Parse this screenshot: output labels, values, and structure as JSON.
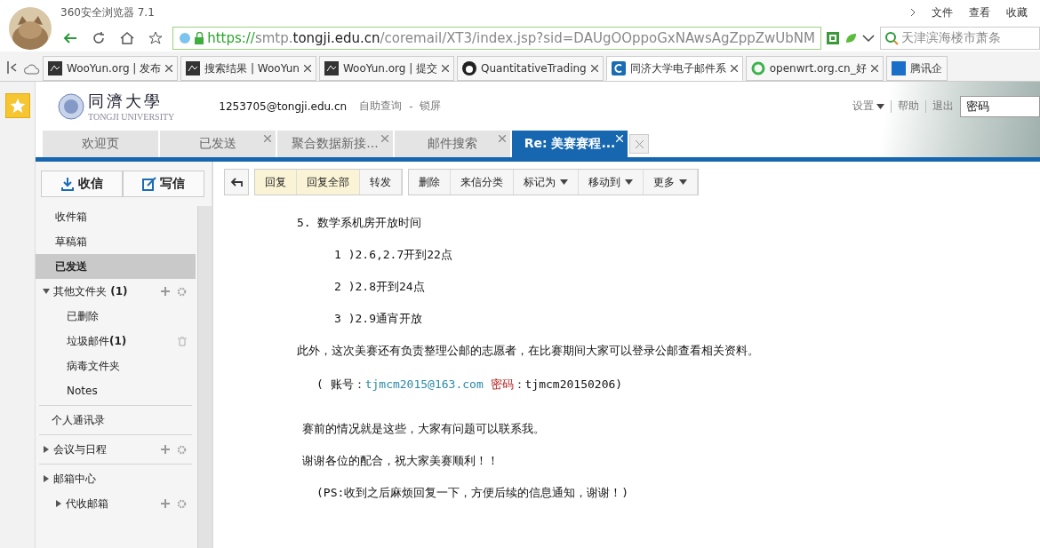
{
  "browser": {
    "title": "360安全浏览器 7.1",
    "menu": [
      "文件",
      "查看",
      "收藏"
    ],
    "url": [
      {
        "kind": "scheme",
        "text": "https://"
      },
      {
        "kind": "sub",
        "text": "smtp."
      },
      {
        "kind": "domain",
        "text": "tongji.edu.cn"
      },
      {
        "kind": "path",
        "text": "/coremail/XT3/index.jsp?sid=DAUgOOppoGxNAwsAgZppZwUbNM"
      }
    ],
    "search": {
      "value": "天津滨海楼市萧条"
    },
    "tabs": [
      {
        "label": "WooYun.org | 发布",
        "selected": false
      },
      {
        "label": "搜索结果 | WooYun",
        "selected": false
      },
      {
        "label": "WooYun.org | 提交",
        "selected": false
      },
      {
        "label": "QuantitativeTrading",
        "selected": false
      },
      {
        "label": "同济大学电子邮件系",
        "selected": true
      },
      {
        "label": "openwrt.org.cn_好",
        "selected": false
      },
      {
        "label": "腾讯企",
        "selected": false
      }
    ]
  },
  "mail": {
    "logo": {
      "cn": "同濟大學",
      "en": "TONGJI UNIVERSITY"
    },
    "account": "1253705@tongji.edu.cn",
    "links": [
      "自助查询",
      "锁屏"
    ],
    "separator": "-",
    "top_links": [
      "设置",
      "帮助",
      "退出"
    ],
    "search": {
      "value": "密码"
    },
    "tabs": [
      {
        "label": "欢迎页",
        "closable": false,
        "selected": false
      },
      {
        "label": "已发送",
        "closable": true,
        "selected": false
      },
      {
        "label": "聚合数据新接...",
        "closable": true,
        "selected": false
      },
      {
        "label": "邮件搜索",
        "closable": true,
        "selected": false
      },
      {
        "label": "Re: 美赛赛程...",
        "closable": true,
        "selected": true
      }
    ],
    "actions": [
      "收信",
      "写信"
    ],
    "toolbar_reply": [
      {
        "label": "回复",
        "highlight": true
      },
      {
        "label": "回复全部",
        "highlight": true
      },
      {
        "label": "转发",
        "highlight": false
      }
    ],
    "toolbar_manage": [
      {
        "label": "删除",
        "dropdown": false
      },
      {
        "label": "来信分类",
        "dropdown": false
      },
      {
        "label": "标记为",
        "dropdown": true
      },
      {
        "label": "移动到",
        "dropdown": true
      },
      {
        "label": "更多",
        "dropdown": true
      }
    ],
    "folders": [
      {
        "label": "收件箱",
        "kind": "plain",
        "selected": false
      },
      {
        "label": "草稿箱",
        "kind": "plain",
        "selected": false
      },
      {
        "label": "已发送",
        "kind": "plain",
        "selected": true
      },
      {
        "label": "其他文件夹",
        "count": "(1)",
        "kind": "group",
        "expanded": true,
        "selected": false,
        "children": [
          {
            "label": "已删除",
            "selected": false
          },
          {
            "label": "垃圾邮件",
            "count": "(1)",
            "selected": false
          },
          {
            "label": "病毒文件夹",
            "selected": false
          },
          {
            "label": "Notes",
            "selected": false
          }
        ]
      },
      {
        "label": "个人通讯录",
        "kind": "section",
        "selected": false
      },
      {
        "label": "会议与日程",
        "kind": "group",
        "expanded": false,
        "selected": false
      },
      {
        "label": "邮箱中心",
        "kind": "center",
        "expanded": false,
        "selected": false
      },
      {
        "label": "代收邮箱",
        "kind": "subgroup",
        "expanded": false,
        "selected": false
      }
    ],
    "body": [
      {
        "kind": "heading",
        "text": "5. 数学系机房开放时间"
      },
      {
        "kind": "sub",
        "text": "1 )2.6,2.7开到22点"
      },
      {
        "kind": "sub",
        "text": "2 )2.8开到24点"
      },
      {
        "kind": "sub",
        "text": "3 )2.9通宵开放"
      },
      {
        "kind": "para",
        "text": "此外，这次美赛还有负责整理公邮的志愿者，在比赛期间大家可以登录公邮查看相关资料。"
      },
      {
        "kind": "account",
        "prefix": "( 账号：",
        "email": "tjmcm2015@163.com",
        "label": "密码",
        "suffix": "：tjmcm20150206)"
      },
      {
        "kind": "gap"
      },
      {
        "kind": "note",
        "text": "赛前的情况就是这些，大家有问题可以联系我。"
      },
      {
        "kind": "note",
        "text": "谢谢各位的配合，祝大家美赛顺利！！"
      },
      {
        "kind": "ps",
        "text": "(PS:收到之后麻烦回复一下，方便后续的信息通知，谢谢！)"
      }
    ]
  }
}
